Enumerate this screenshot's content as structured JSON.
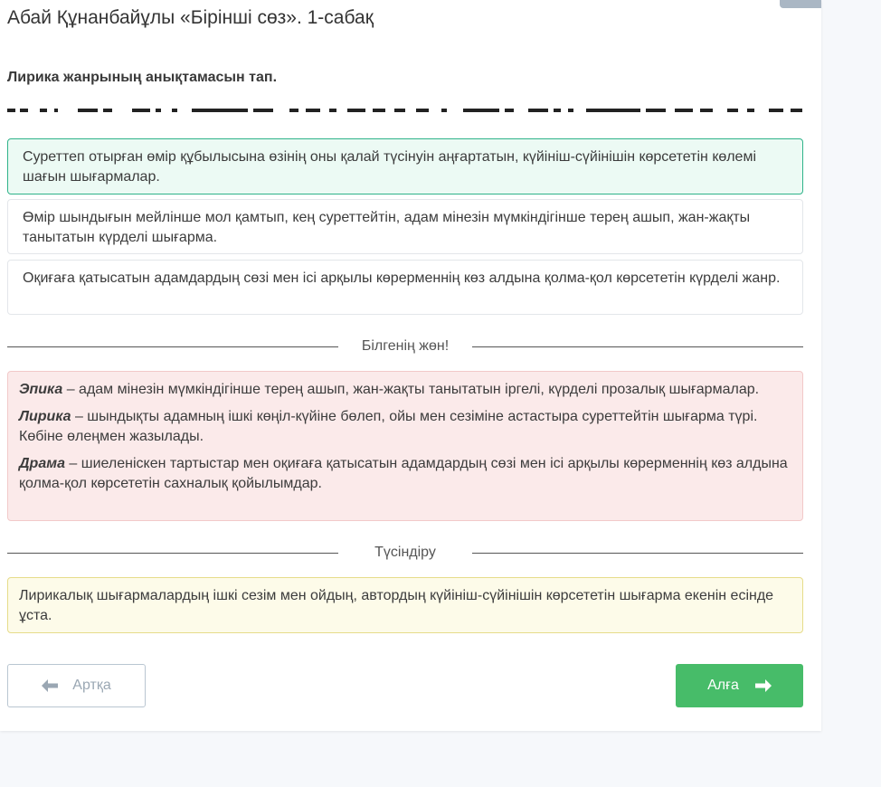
{
  "page": {
    "title": "Абай Құнанбайұлы «Бірінші сөз». 1-сабақ",
    "question": "Лирика жанрының анықтамасын тап."
  },
  "options": [
    {
      "text": "Суреттеп отырған өмір құбылысына өзінің оны қалай түсінуін аңғартатын, күйініш-сүйінішін көрсететін көлемі шағын шығармалар.",
      "state": "correct"
    },
    {
      "text": "Өмір шындығын мейлінше мол қамтып, кең суреттейтін, адам мінезін мүмкіндігінше терең ашып, жан-жақты танытатын күрделі шығарма.",
      "state": "normal"
    },
    {
      "text": "Оқиғаға қатысатын адамдардың сөзі мен ісі арқылы көрерменнің көз алдына қолма-қол көрсететін күрделі жанр.",
      "state": "normal"
    }
  ],
  "known": {
    "heading": "Білгенің жөн!",
    "items": [
      {
        "term": "Эпика",
        "text": " – адам мінезін мүмкіндігінше терең ашып, жан-жақты танытатын іргелі, күрделі прозалық шығармалар."
      },
      {
        "term": "Лирика",
        "text": " – шындықты адамның ішкі көңіл-күйіне бөлеп, ойы мен сезіміне астастыра суреттейтін шығарма түрі. Көбіне өлеңмен жазылады."
      },
      {
        "term": "Драма",
        "text": " – шиеленіскен тартыстар мен оқиғаға қатысатын адамдардың сөзі мен ісі арқылы көрерменнің көз алдына қолма-қол көрсететін сахналық қойылымдар."
      }
    ]
  },
  "explain": {
    "heading": "Түсіндіру",
    "text": "Лирикалық шығармалардың ішкі сезім мен ойдың, автордың күйініш-сүйінішін көрсететін шығарма екенін есінде ұста."
  },
  "nav": {
    "back_label": "Артқа",
    "next_label": "Алға",
    "back_icon": "arrow-left-icon",
    "next_icon": "arrow-right-icon"
  },
  "colors": {
    "correct_border": "#2fb38a",
    "correct_bg": "#ecfaf4",
    "info_bg": "#fbeaea",
    "hint_bg": "#fdfbe9",
    "next_button": "#47bc69"
  }
}
